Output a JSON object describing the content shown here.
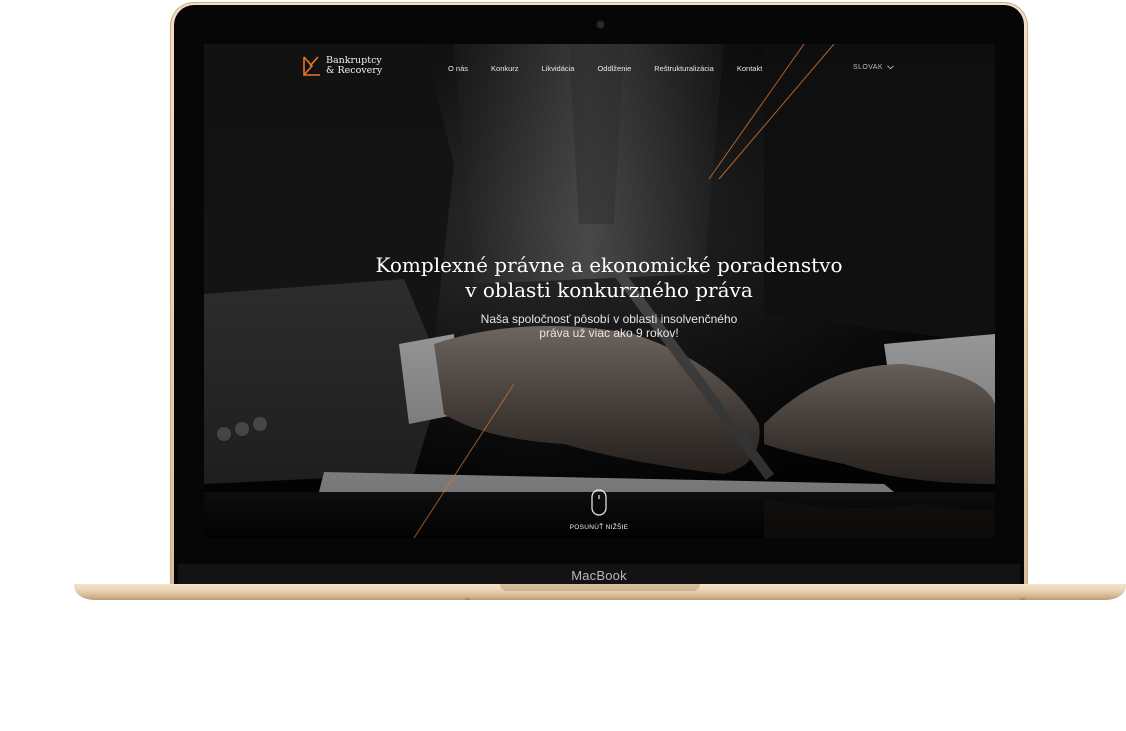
{
  "device": {
    "brand_label": "MacBook"
  },
  "site": {
    "logo": {
      "line1": "Bankruptcy",
      "line2": "& Recovery",
      "accent_color": "#e8752a"
    },
    "nav": {
      "items": [
        {
          "label": "O nás"
        },
        {
          "label": "Konkurz"
        },
        {
          "label": "Likvidácia"
        },
        {
          "label": "Oddlženie"
        },
        {
          "label": "Reštrukturalizácia"
        },
        {
          "label": "Kontakt"
        }
      ],
      "language": {
        "selected": "SLOVAK",
        "icon": "chevron-down-icon"
      }
    },
    "hero": {
      "title_line1": "Komplexné právne a ekonomické poradenstvo",
      "title_line2": "v oblasti konkurzného práva",
      "subtitle_line1": "Naša spoločnosť pôsobí v oblasti insolvenčného",
      "subtitle_line2": "práva už viac ako 9 rokov!",
      "scroll_label": "POSUNÚŤ NIŽŠIE",
      "scroll_icon": "mouse-icon"
    }
  }
}
